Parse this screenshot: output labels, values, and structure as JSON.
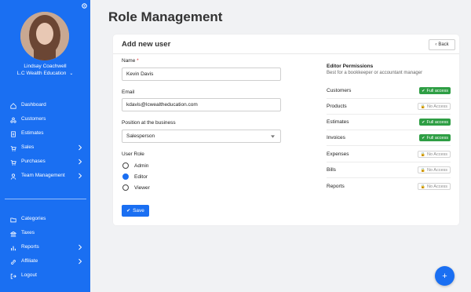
{
  "sidebar": {
    "user": {
      "name": "Lindsay Coachwell",
      "company": "L.C Wealth Education"
    },
    "nav": [
      {
        "label": "Dashboard",
        "icon": "home-icon"
      },
      {
        "label": "Customers",
        "icon": "users-icon"
      },
      {
        "label": "Estimates",
        "icon": "document-icon"
      },
      {
        "label": "Sales",
        "icon": "cart-icon"
      },
      {
        "label": "Purchases",
        "icon": "cart-icon"
      },
      {
        "label": "Team Management",
        "icon": "user-icon"
      }
    ],
    "bottom_nav": [
      {
        "label": "Categories",
        "icon": "folder-icon"
      },
      {
        "label": "Taxes",
        "icon": "bank-icon"
      },
      {
        "label": "Reports",
        "icon": "chart-icon"
      },
      {
        "label": "Affiliate",
        "icon": "link-icon"
      },
      {
        "label": "Logout",
        "icon": "logout-icon"
      }
    ]
  },
  "main": {
    "title": "Role Management",
    "card_title": "Add new user",
    "back_label": "Back",
    "fields": {
      "name_label": "Name",
      "name_required": "*",
      "name_value": "Kevin Davis",
      "email_label": "Email",
      "email_value": "kdavis@lcwealtheducation.com",
      "position_label": "Position at the business",
      "position_value": "Salesperson"
    },
    "user_role": {
      "label": "User Role",
      "options": [
        "Admin",
        "Editor",
        "Viewer"
      ],
      "selected": "Editor"
    },
    "save_label": "Save",
    "permissions": {
      "title": "Editor Permissions",
      "subtitle": "Best for a bookkeeper or accountant manager",
      "rows": [
        {
          "name": "Customers",
          "access": "Full access"
        },
        {
          "name": "Products",
          "access": "No Access"
        },
        {
          "name": "Estimates",
          "access": "Full access"
        },
        {
          "name": "Invoices",
          "access": "Full access"
        },
        {
          "name": "Expenses",
          "access": "No Access"
        },
        {
          "name": "Bills",
          "access": "No Access"
        },
        {
          "name": "Reports",
          "access": "No Access"
        }
      ]
    },
    "fab_label": "+"
  },
  "colors": {
    "primary": "#1a6ff2",
    "full_access": "#2e9e44",
    "background": "#f1f2f4"
  }
}
